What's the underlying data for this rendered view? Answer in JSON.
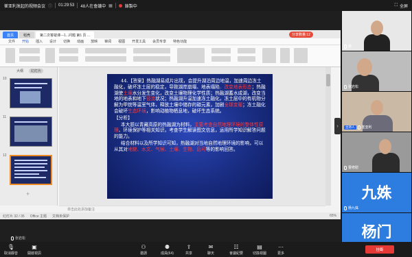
{
  "topbar": {
    "meeting_title": "崔亚利发起的视频会议",
    "duration": "01:29:53",
    "attendee_count": "48人在會議中",
    "recording_label": "錄製中",
    "fullscreen_label": "全屏"
  },
  "wps": {
    "tabs": [
      "首页",
      "稻壳",
      "第二次答疑课---1...问题 第1 页 ..."
    ],
    "recording_pill": "分享數量:12",
    "menu": [
      "文件",
      "开始",
      "插入",
      "设计",
      "切换",
      "动画",
      "放映",
      "审阅",
      "视图",
      "开发工具",
      "会员专享",
      "特色功能"
    ],
    "menu_active": "开始",
    "thumb_head": [
      "大纲",
      "幻灯片"
    ],
    "slide_numbers": [
      "10",
      "11",
      "12"
    ],
    "notes_placeholder": "单击此处添加备注",
    "status_left": "幻灯片 32 / 35",
    "status_theme": "Office 主题",
    "status_protect": "文档未保护",
    "zoom": "65%"
  },
  "slide": {
    "p1_a": "44.【答案】热融湖易成片出现，会提升湖泊周边地温，加速周边冻土融化，破坏冻土层的稳定，导致湖岸崩塌、地表塌陷",
    "p1_red1": "，改变地表形态",
    "p1_b": "；热融湖使",
    "p1_red2": "土壤",
    "p1_c": "水分发生变化，改变土壤物理化学性质；热融湖蓄水成湖，改变当地的地表和地下",
    "p1_red3": "径流",
    "p1_d": "状况；热融湖升温加速冻土融化，冻土层中的有机物分解为甲烷等温室气体，释放土壤中储存的碳元素，加剧",
    "p1_red4": "全球变暖",
    "p1_e": "；冻土融化会破坏",
    "p1_red5": "生态环境",
    "p1_f": "，影响动植物栖息地，破坏生态系统。",
    "analysis_title": "【分析】",
    "p2_a": "本大题以青藏高原的热融湖为材料，",
    "p2_red": "主要考查自然地理环境的整体性原理",
    "p2_b": "、环境保护等相关知识，考查学生解读图文信息，运用所学知识解答问题的能力。",
    "p3_a": "结合材料以及所学知识可知，热融湖对当地自然地理环境的影响，可以从其对",
    "p3_red": "地貌、水文、气候、土壤、生物、后可",
    "p3_b": "等的影响回答。"
  },
  "participants": [
    {
      "name": "我",
      "muted": true,
      "host": false
    },
    {
      "name": "张岩松",
      "muted": true,
      "host": false
    },
    {
      "name": "崔亚利",
      "muted": false,
      "host": true,
      "host_label": "主持人"
    },
    {
      "name": "曹修慰",
      "muted": true,
      "host": false
    },
    {
      "name": "杨九姝",
      "muted": true,
      "host": false,
      "avatar_text": "九姝"
    },
    {
      "name": "",
      "muted": true,
      "host": false,
      "avatar_text": "杨门"
    }
  ],
  "self_name": "张岩松",
  "bottombar": {
    "items": [
      {
        "label": "取消靜音",
        "icon": "mic-icon"
      },
      {
        "label": "開啟視訊",
        "icon": "camera-icon"
      },
      {
        "label": "邀請",
        "icon": "invite-icon"
      },
      {
        "label": "成員(64)",
        "icon": "members-icon"
      },
      {
        "label": "共享",
        "icon": "share-icon"
      },
      {
        "label": "聊天",
        "icon": "chat-icon"
      },
      {
        "label": "會議紀要",
        "icon": "notes-icon"
      },
      {
        "label": "切換視圖",
        "icon": "layout-icon"
      },
      {
        "label": "更多",
        "icon": "more-icon"
      }
    ],
    "end_label": "挂斷"
  }
}
